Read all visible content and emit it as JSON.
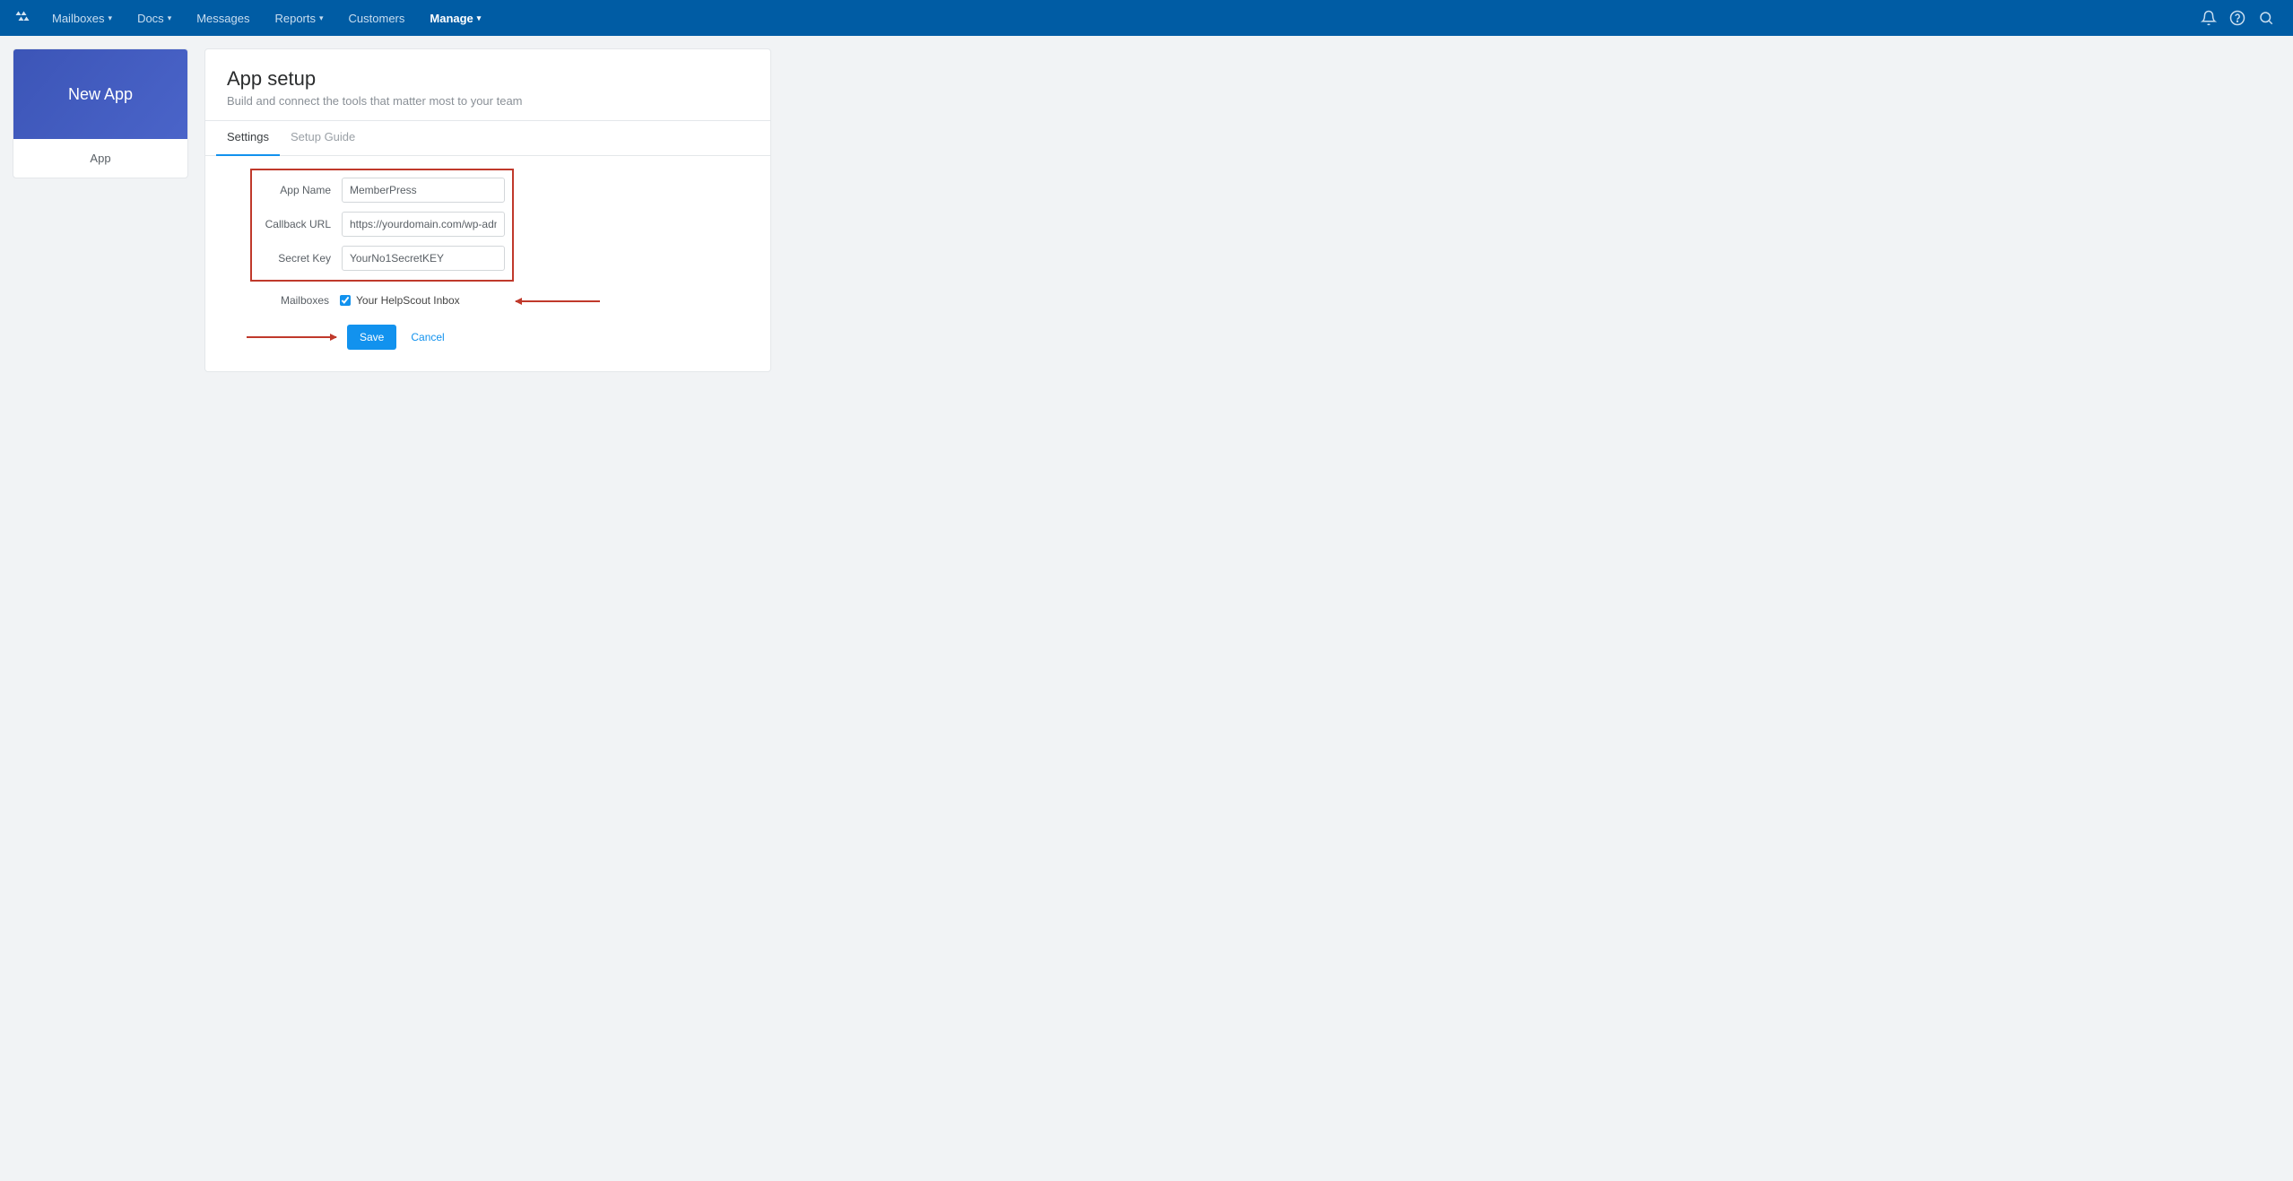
{
  "nav": {
    "mailboxes": "Mailboxes",
    "docs": "Docs",
    "messages": "Messages",
    "reports": "Reports",
    "customers": "Customers",
    "manage": "Manage"
  },
  "sidecard": {
    "title": "New App",
    "row": "App"
  },
  "panel": {
    "title": "App setup",
    "subtitle": "Build and connect the tools that matter most to your team"
  },
  "tabs": {
    "settings": "Settings",
    "guide": "Setup Guide"
  },
  "form": {
    "app_name_label": "App Name",
    "app_name_value": "MemberPress",
    "callback_label": "Callback URL",
    "callback_value": "https://yourdomain.com/wp-admin/admin-a",
    "secret_label": "Secret Key",
    "secret_value": "YourNo1SecretKEY",
    "mailboxes_label": "Mailboxes",
    "mailbox_option": "Your HelpScout Inbox"
  },
  "buttons": {
    "save": "Save",
    "cancel": "Cancel"
  }
}
